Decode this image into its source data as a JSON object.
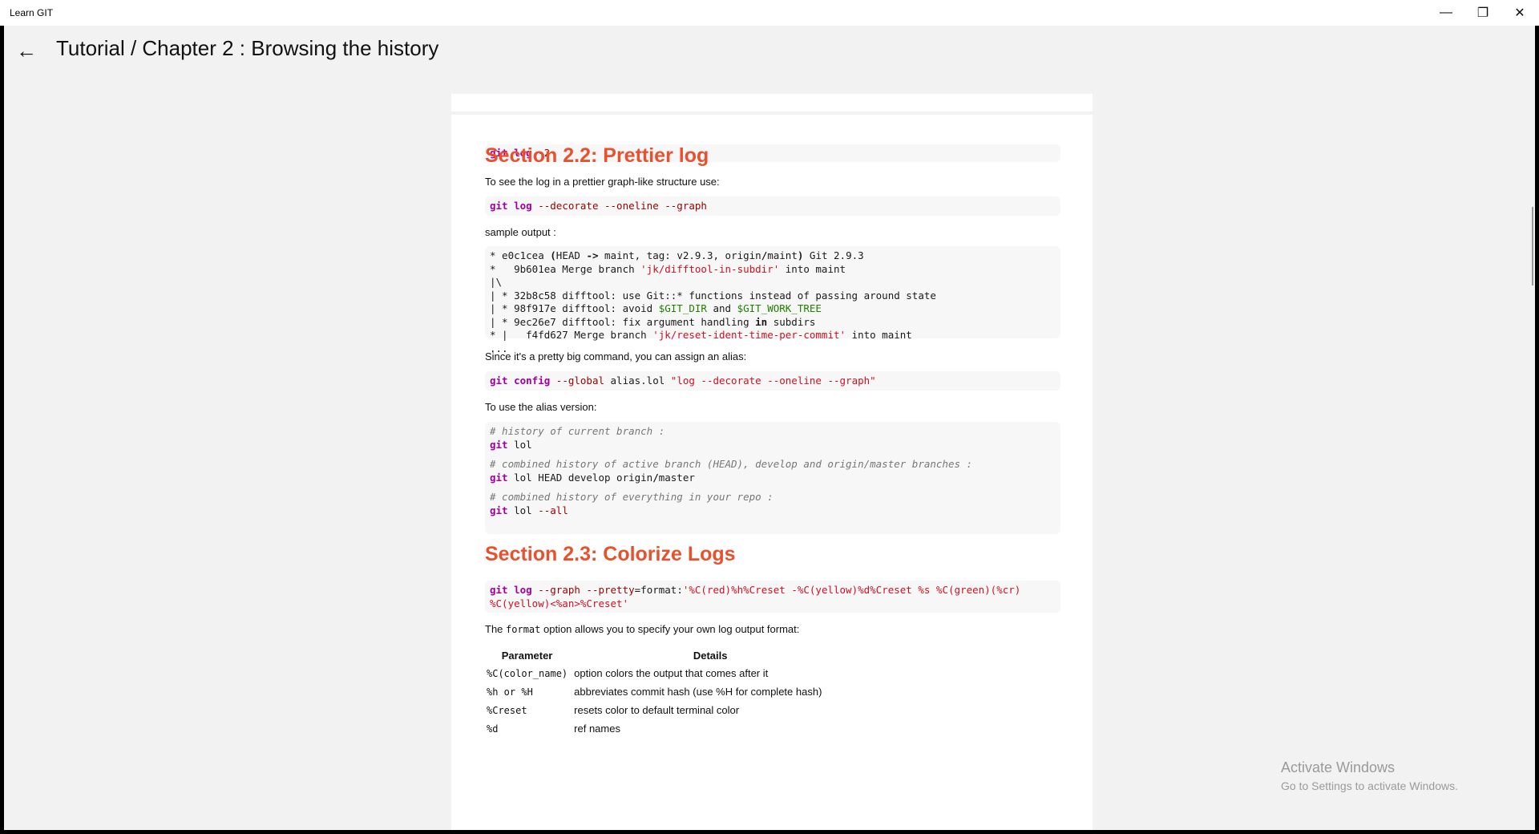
{
  "window": {
    "app_name": "Learn GIT",
    "minimize_glyph": "—",
    "maximize_glyph": "❐",
    "close_glyph": "✕"
  },
  "header": {
    "back_glyph": "←",
    "title": "Tutorial / Chapter 2 :  Browsing the history"
  },
  "content": {
    "code1": [
      "git",
      " log ",
      "-2"
    ],
    "section_22_title": "Section 2.2: Prettier log",
    "p_prettier": "To see the log in a prettier graph-like structure use:",
    "code2": [
      "git",
      " ",
      "log",
      " --decorate --oneline --graph"
    ],
    "p_sample": "sample output :",
    "sample_output": {
      "l1": [
        "* e0c1cea ",
        "(",
        "HEAD ",
        "->",
        " maint, tag: v2.9.3, origin",
        "/",
        "maint",
        ")",
        " Git 2.9.3"
      ],
      "l2": [
        "*   9b601ea Merge branch ",
        "'jk/difftool-in-subdir'",
        " into maint"
      ],
      "l3": "|\\",
      "l4": "| * 32b8c58 difftool: use Git::* functions instead of passing around state",
      "l5": [
        "| * 98f917e difftool: avoid ",
        "$GIT_DIR",
        " and ",
        "$GIT_WORK_TREE"
      ],
      "l6": [
        "| * 9ec26e7 difftool: fix argument handling ",
        "in",
        " subdirs"
      ],
      "l7": [
        "* |   f4fd627 Merge branch ",
        "'jk/reset-ident-time-per-commit'",
        " into maint"
      ],
      "l8": "..."
    },
    "p_alias": "Since it's a pretty big command, you can assign an alias:",
    "code3": [
      "git",
      " ",
      "config",
      " --global",
      " alias.lol ",
      "\"log --decorate --oneline --graph\""
    ],
    "p_use_alias": "To use the alias version:",
    "alias_block": {
      "c1": "# history of current branch :",
      "l1": [
        "git",
        " lol"
      ],
      "c2": "# combined history of active branch (HEAD), develop and origin/master branches :",
      "l2": [
        "git",
        " lol HEAD develop origin",
        "/",
        "master"
      ],
      "c3": "# combined history of everything in your repo :",
      "l3": [
        "git",
        " lol ",
        "--all"
      ]
    },
    "section_23_title": "Section 2.3: Colorize Logs",
    "code4": {
      "l1": [
        "git",
        " ",
        "log",
        " --graph",
        " --pretty",
        "=format:",
        "'%C(red)%h%Creset -%C(yellow)%d%Creset %s %C(green)(%cr)"
      ],
      "l2": "%C(yellow)<%an>%Creset'"
    },
    "p_format": [
      "The ",
      "format",
      " option allows you to specify your own log output format:"
    ],
    "table": {
      "headers": [
        "Parameter",
        "Details"
      ],
      "rows": [
        [
          "%C(color_name)",
          "option colors the output that comes after it"
        ],
        [
          "%h or %H",
          "abbreviates commit hash (use %H for complete hash)"
        ],
        [
          "%Creset",
          "resets color to default terminal color"
        ],
        [
          "%d",
          "ref names"
        ]
      ]
    }
  },
  "watermark": {
    "title": "Activate Windows",
    "subtitle": "Go to Settings to activate Windows."
  }
}
